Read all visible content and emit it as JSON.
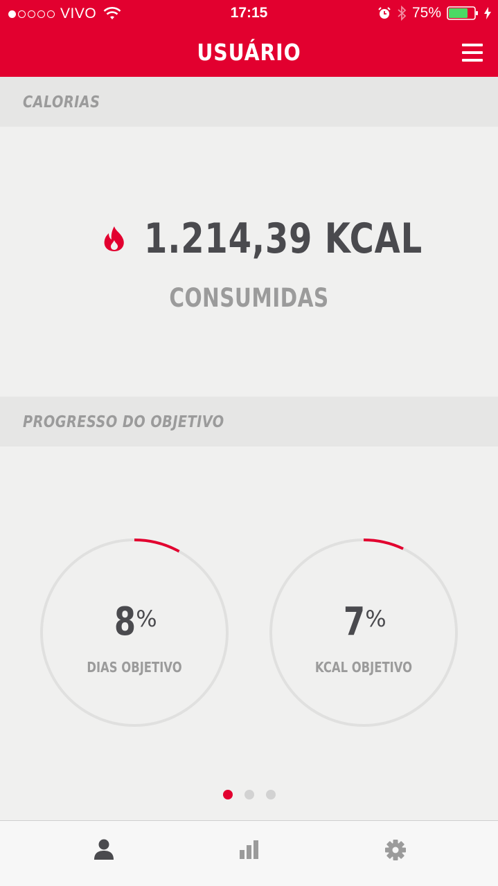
{
  "status_bar": {
    "carrier": "VIVO",
    "signal_dots_filled": 1,
    "signal_dots_total": 5,
    "time": "17:15",
    "battery_percent": "75%",
    "battery_level": 0.75,
    "icons": [
      "wifi-icon",
      "alarm-icon",
      "bluetooth-icon",
      "battery-icon",
      "charging-icon"
    ]
  },
  "header": {
    "title": "USUÁRIO",
    "menu_icon": "hamburger-menu-icon"
  },
  "calories": {
    "section_label": "CALORIAS",
    "value": "1.214,39 KCAL",
    "subtitle": "CONSUMIDAS",
    "icon": "flame-icon"
  },
  "progress": {
    "section_label": "PROGRESSO DO OBJETIVO",
    "gauges": [
      {
        "value": "8",
        "unit": "%",
        "label": "DIAS OBJETIVO",
        "fraction": 0.08
      },
      {
        "value": "7",
        "unit": "%",
        "label": "KCAL OBJETIVO",
        "fraction": 0.07
      }
    ],
    "pager": {
      "pages": 3,
      "active": 0
    }
  },
  "tab_bar": {
    "tabs": [
      {
        "icon": "user-icon",
        "active": true
      },
      {
        "icon": "bar-chart-icon",
        "active": false
      },
      {
        "icon": "gear-icon",
        "active": false
      }
    ]
  },
  "colors": {
    "accent": "#e2002f",
    "background": "#f0f0ef",
    "section_header_bg": "#e6e6e5",
    "text_dark": "#4a4a4e",
    "text_muted": "#9b9b9b",
    "ring_track": "#e0e0df"
  }
}
